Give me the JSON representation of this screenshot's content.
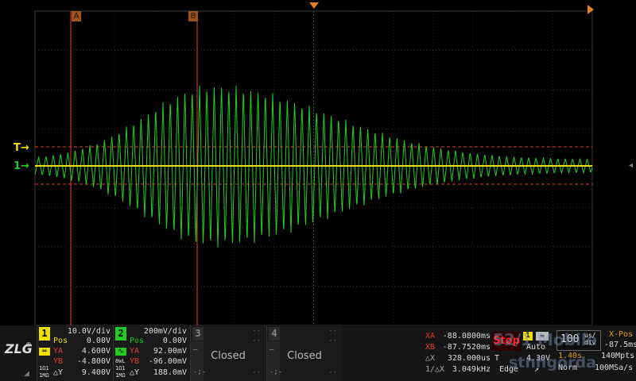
{
  "screen": {
    "cursor_a_label": "A",
    "cursor_b_label": "B",
    "trigger_marker": "T",
    "ch1_marker": "1",
    "colors": {
      "ch1": "#f0e000",
      "ch2": "#22cc22",
      "cursor": "#e04030",
      "grid": "#2f2f2f"
    }
  },
  "logo": {
    "text": "ZLG",
    "reg": "®"
  },
  "ch1": {
    "number": "1",
    "scale": "10.0V/div",
    "pos_label": "Pos",
    "pos_value": "0.00V",
    "ya_label": "YA",
    "ya_value": "4.600V",
    "yb_label": "YB",
    "yb_value": "-4.800V",
    "dy_label": "△Y",
    "dy_value": "9.400V",
    "coupling_1": "1Ω1",
    "coupling_2": "1MΩ"
  },
  "ch2": {
    "number": "2",
    "scale": "200mV/div",
    "pos_label": "Pos",
    "pos_value": "0.00V",
    "ya_label": "YA",
    "ya_value": "92.00mV",
    "yb_label": "YB",
    "yb_value": "-96.00mV",
    "dy_label": "△Y",
    "dy_value": "188.0mV",
    "coupling_0": "8wL",
    "coupling_1": "1Ω1",
    "coupling_2": "1MΩ"
  },
  "ch3": {
    "number": "3",
    "status": "Closed",
    "dash": "--"
  },
  "ch4": {
    "number": "4",
    "status": "Closed",
    "dash": "--"
  },
  "measure": {
    "xa_label": "XA",
    "xa_value": "-88.0800ms",
    "xb_label": "XB",
    "xb_value": "-87.7520ms",
    "dx_label": "△X",
    "dx_value": "328.000us",
    "inv_label": "1/△X",
    "inv_value": "3.049kHz"
  },
  "run_state": "Stop",
  "trigger": {
    "source": "1",
    "mode": "Auto",
    "level": "4.30V",
    "type_label": "T",
    "edge_label": "Edge"
  },
  "timebase": {
    "value": "100",
    "unit_top": "us/",
    "unit_bottom": "div",
    "xpos_label": "X-Pos",
    "xpos_value": "-87.5ms",
    "time_len": "1.40s",
    "memory": "140Mpts",
    "acq_mode": "Norm",
    "sample_rate": "100MSa/s"
  },
  "watermark": {
    "line1": "52/1 Mobile",
    "line2": "stnhgorda"
  }
}
